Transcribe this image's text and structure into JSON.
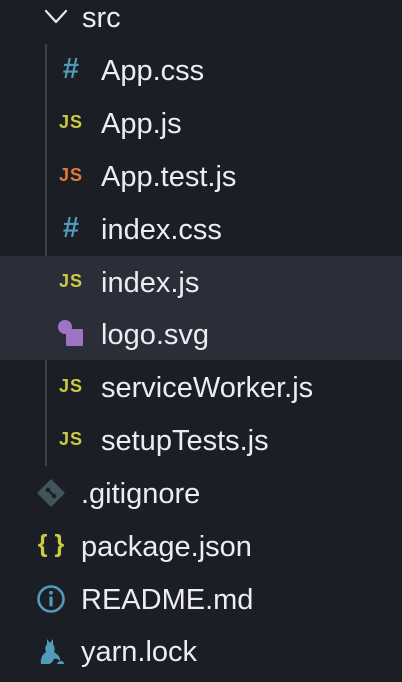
{
  "explorer": {
    "folder": {
      "name": "src",
      "expanded": true,
      "icon": "chevron-down-icon"
    },
    "folder_children": [
      {
        "name": "App.css",
        "icon": "css-hash-icon",
        "icon_text": "#",
        "icon_color": "#519aba"
      },
      {
        "name": "App.js",
        "icon": "javascript-icon",
        "icon_text": "JS",
        "icon_color": "#cbcb41"
      },
      {
        "name": "App.test.js",
        "icon": "javascript-test-icon",
        "icon_text": "JS",
        "icon_color": "#e37933"
      },
      {
        "name": "index.css",
        "icon": "css-hash-icon",
        "icon_text": "#",
        "icon_color": "#519aba"
      },
      {
        "name": "index.js",
        "icon": "javascript-icon",
        "icon_text": "JS",
        "icon_color": "#cbcb41",
        "selected": true
      },
      {
        "name": "logo.svg",
        "icon": "svg-image-icon",
        "icon_color": "#a074c4",
        "selected": true
      },
      {
        "name": "serviceWorker.js",
        "icon": "javascript-icon",
        "icon_text": "JS",
        "icon_color": "#cbcb41"
      },
      {
        "name": "setupTests.js",
        "icon": "javascript-icon",
        "icon_text": "JS",
        "icon_color": "#cbcb41"
      }
    ],
    "root_files": [
      {
        "name": ".gitignore",
        "icon": "git-diamond-icon",
        "icon_color": "#41535b"
      },
      {
        "name": "package.json",
        "icon": "json-braces-icon",
        "icon_text": "{ }",
        "icon_color": "#cbcb41"
      },
      {
        "name": "README.md",
        "icon": "info-icon",
        "icon_text": "i",
        "icon_color": "#519aba"
      },
      {
        "name": "yarn.lock",
        "icon": "yarn-cat-icon",
        "icon_color": "#519aba"
      }
    ]
  }
}
